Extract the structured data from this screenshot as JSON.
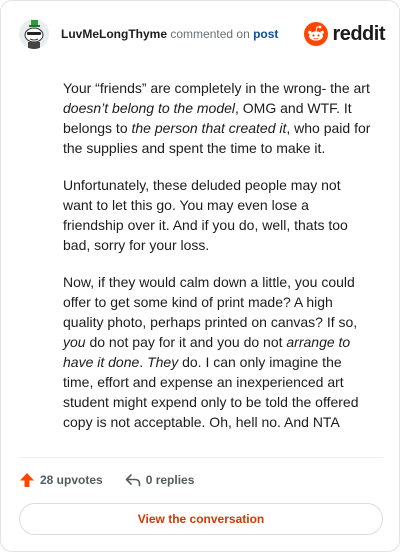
{
  "header": {
    "username": "LuvMeLongThyme",
    "action_text": "commented on",
    "target_link": "post",
    "brand_name": "reddit"
  },
  "comment": {
    "paragraphs": [
      [
        {
          "t": "Your “friends” are completely in the wrong- the art "
        },
        {
          "t": "doesn’t belong to the model",
          "i": true
        },
        {
          "t": ", OMG and WTF. It belongs to "
        },
        {
          "t": "the person that created it",
          "i": true
        },
        {
          "t": ", who paid for the supplies and spent the time to make it."
        }
      ],
      [
        {
          "t": "Unfortunately, these deluded people may not want to let this go. You may even lose a friendship over it. And if you do, well, thats too bad, sorry for your loss."
        }
      ],
      [
        {
          "t": "Now, if they would calm down a little, you could offer to get some kind of print made? A high quality photo, perhaps printed on canvas? If so, "
        },
        {
          "t": "you",
          "i": true
        },
        {
          "t": " do not pay for it and you do not "
        },
        {
          "t": "arrange to have it done",
          "i": true
        },
        {
          "t": ". "
        },
        {
          "t": "They",
          "i": true
        },
        {
          "t": " do. I can only imagine the time, effort and expense an inexperienced art student might expend only to be told the offered copy is not acceptable. Oh, hell no. And NTA"
        }
      ]
    ]
  },
  "actions": {
    "upvotes": "28 upvotes",
    "replies": "0 replies"
  },
  "footer": {
    "button_label": "View the conversation"
  },
  "colors": {
    "upvote": "#ff4500",
    "brand": "#ff4500",
    "link": "#0b4f9c",
    "button_text": "#d13a00"
  },
  "icons": {
    "avatar": "snoo-avatar-with-green-hat",
    "brand": "reddit-snoo-logo",
    "upvote": "upvote-arrow-icon",
    "reply": "reply-arrow-icon"
  }
}
